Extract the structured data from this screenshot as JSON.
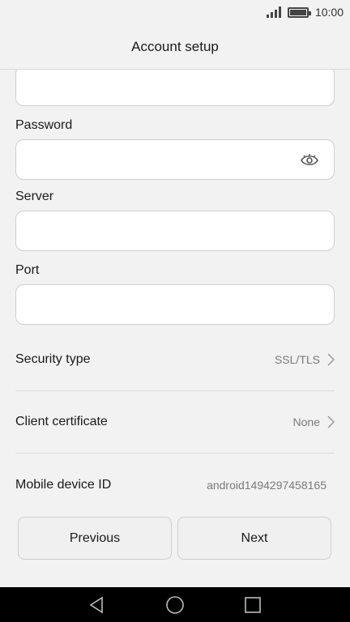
{
  "status_bar": {
    "time": "10:00",
    "battery_level": 1.0,
    "signal_bars": 4
  },
  "header": {
    "title": "Account setup"
  },
  "form": {
    "password_label": "Password",
    "server_label": "Server",
    "port_label": "Port"
  },
  "settings": [
    {
      "label": "Security type",
      "value": "SSL/TLS",
      "has_chevron": true
    },
    {
      "label": "Client certificate",
      "value": "None",
      "has_chevron": true
    },
    {
      "label": "Mobile device ID",
      "value": "android1494297458165",
      "has_chevron": false
    }
  ],
  "buttons": {
    "previous": "Previous",
    "next": "Next"
  },
  "icons": {
    "eye": "eye-icon",
    "back": "back-triangle-icon",
    "home": "home-circle-icon",
    "recents": "recents-square-icon"
  }
}
